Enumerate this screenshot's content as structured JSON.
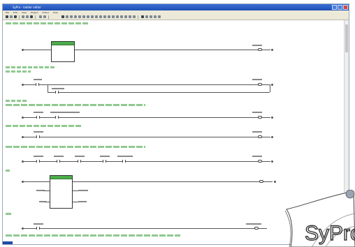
{
  "window": {
    "title": "SyPro - ladder editor",
    "controls": [
      "minimize",
      "maximize",
      "close"
    ]
  },
  "menu": [
    "File",
    "Edit",
    "View",
    "Project",
    "Online",
    "Help"
  ],
  "logo": {
    "text": "SyPro",
    "icon": "syp-logo-icon"
  },
  "colors": {
    "titlebar": "#2a5cc5",
    "comment": "#3e9a3e",
    "block_header": "#4cae4c",
    "rail": "#555555"
  }
}
